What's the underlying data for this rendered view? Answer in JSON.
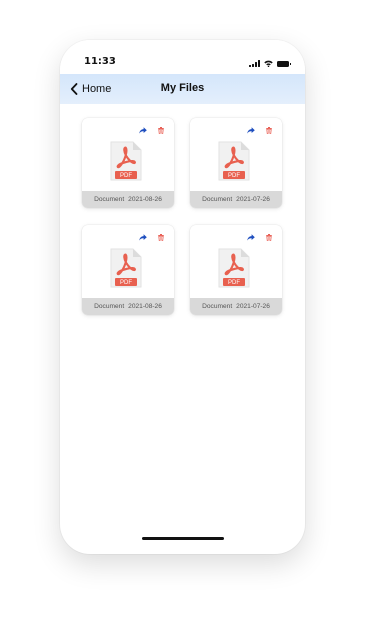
{
  "status_bar": {
    "time": "11:33"
  },
  "nav": {
    "back_label": "Home",
    "title": "My Files"
  },
  "files": [
    {
      "name": "Document",
      "date": "2021-08-26",
      "type_label": "PDF"
    },
    {
      "name": "Document",
      "date": "2021-07-26",
      "type_label": "PDF"
    },
    {
      "name": "Document",
      "date": "2021-08-26",
      "type_label": "PDF"
    },
    {
      "name": "Document",
      "date": "2021-07-26",
      "type_label": "PDF"
    }
  ],
  "colors": {
    "share_icon": "#1f4fbf",
    "delete_icon": "#e85a4f",
    "pdf_badge": "#e8604f",
    "nav_background": "#dbe9fb",
    "card_footer": "#d9d9d9"
  }
}
